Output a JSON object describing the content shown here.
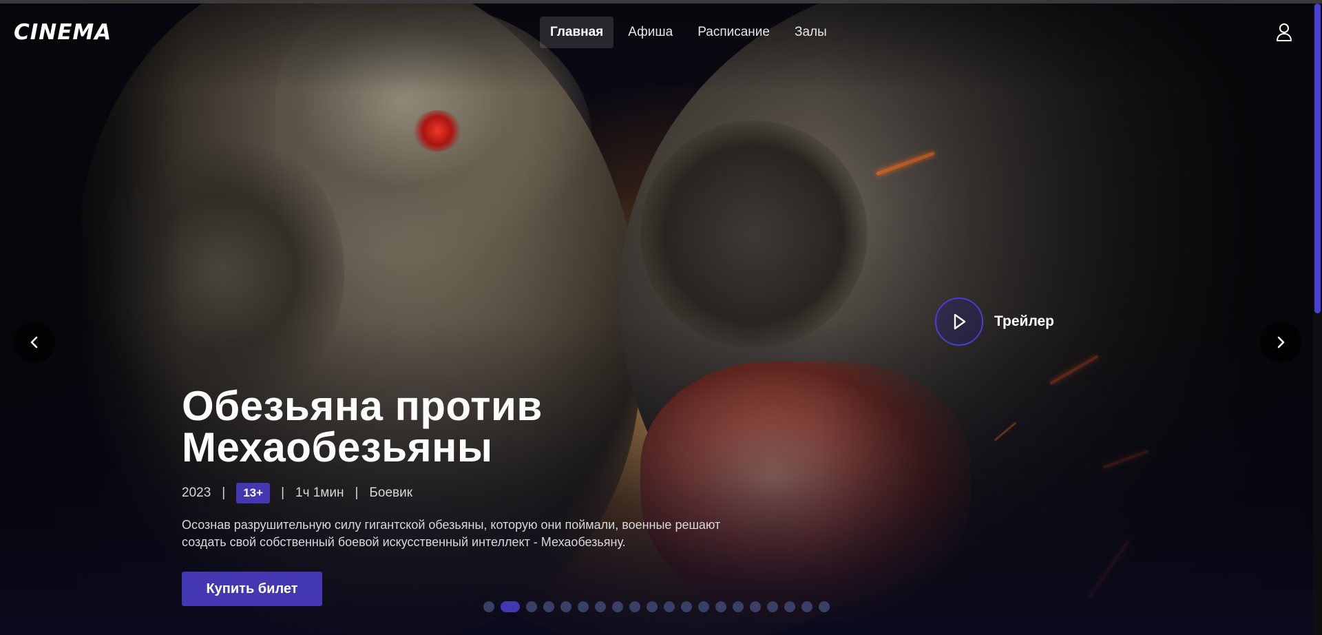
{
  "app": {
    "logo": "CINEMA"
  },
  "nav": {
    "items": [
      {
        "label": "Главная",
        "active": true
      },
      {
        "label": "Афиша",
        "active": false
      },
      {
        "label": "Расписание",
        "active": false
      },
      {
        "label": "Залы",
        "active": false
      }
    ],
    "user_icon": "user-icon"
  },
  "hero": {
    "title": "Обезьяна против Мехаобезьяны",
    "year": "2023",
    "rating": "13+",
    "duration": "1ч 1мин",
    "genre": "Боевик",
    "separator": "|",
    "description": "Осознав разрушительную силу гигантской обезьяны, которую они поймали, военные решают создать свой собственный боевой искусственный интеллект - Мехаобезьяну.",
    "buy_label": "Купить билет",
    "trailer_label": "Трейлер"
  },
  "carousel": {
    "slides": 20,
    "active_index": 1
  },
  "colors": {
    "accent": "#4338b2",
    "dot_inactive": "#3a3f66",
    "scroll_thumb": "#4a3fd6"
  },
  "icons": {
    "prev": "chevron-left-icon",
    "next": "chevron-right-icon",
    "play": "play-icon"
  }
}
